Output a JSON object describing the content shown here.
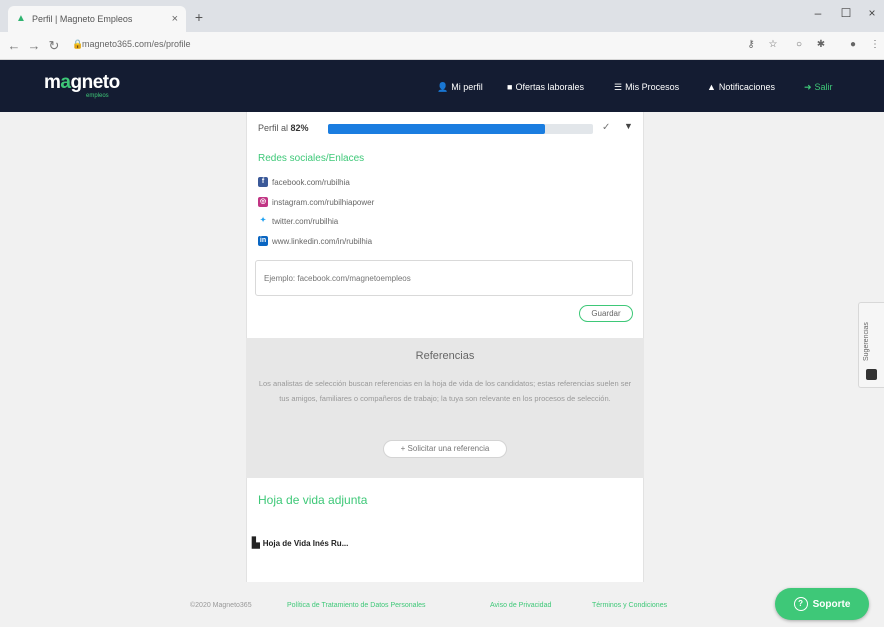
{
  "browser": {
    "tab_title": "Perfil | Magneto Empleos",
    "tab_close": "×",
    "new_tab": "+",
    "url": "magneto365.com/es/profile",
    "window": {
      "minimize": "–",
      "maximize": "☐",
      "close": "×"
    }
  },
  "header": {
    "logo_prefix": "m",
    "logo_accent": "a",
    "logo_rest": "gneto",
    "logo_sub": "empleos",
    "nav": [
      {
        "label": "Mi perfil",
        "icon": "person-icon"
      },
      {
        "label": "Ofertas laborales",
        "icon": "briefcase-icon"
      },
      {
        "label": "Mis Procesos",
        "icon": "list-icon"
      },
      {
        "label": "Notificaciones",
        "icon": "bell-icon"
      },
      {
        "label": "Salir",
        "icon": "exit-icon"
      }
    ]
  },
  "profile": {
    "progress_label": "Perfil al",
    "progress_value": "82%",
    "progress_fraction": 0.82
  },
  "social": {
    "title": "Redes sociales/Enlaces",
    "items": [
      {
        "network": "facebook",
        "text": "facebook.com/rubilhia",
        "color": "#3b5998",
        "glyph": "f"
      },
      {
        "network": "instagram",
        "text": "instagram.com/rubilhiapower",
        "color": "#c13584",
        "glyph": "◎"
      },
      {
        "network": "twitter",
        "text": "twitter.com/rubilhia",
        "color": "#1da1f2",
        "glyph": "✦"
      },
      {
        "network": "linkedin",
        "text": "www.linkedin.com/in/rubilhia",
        "color": "#0a66c2",
        "glyph": "in"
      }
    ],
    "input_placeholder": "Ejemplo: facebook.com/magnetoempleos",
    "save_label": "Guardar"
  },
  "references": {
    "title": "Referencias",
    "text": "Los analistas de selección buscan referencias en la hoja de vida de los candidatos; estas referencias suelen ser tus amigos, familiares o compañeros de trabajo; la tuya son relevante en los procesos de selección.",
    "button_label": "+ Solicitar una referencia"
  },
  "cv": {
    "title": "Hoja de vida adjunta",
    "file_name": "Hoja de Vida Inés Ru..."
  },
  "footer": {
    "copyright": "©2020 Magneto365",
    "links": [
      "Política de Tratamiento de Datos Personales",
      "Aviso de Privacidad",
      "Términos y Condiciones"
    ]
  },
  "support": {
    "label": "Soporte",
    "icon": "?"
  },
  "suggestions": {
    "label": "Sugerencias"
  },
  "colors": {
    "brand_green": "#3ec878",
    "header_bg": "#141c32",
    "progress": "#1a7de0"
  }
}
